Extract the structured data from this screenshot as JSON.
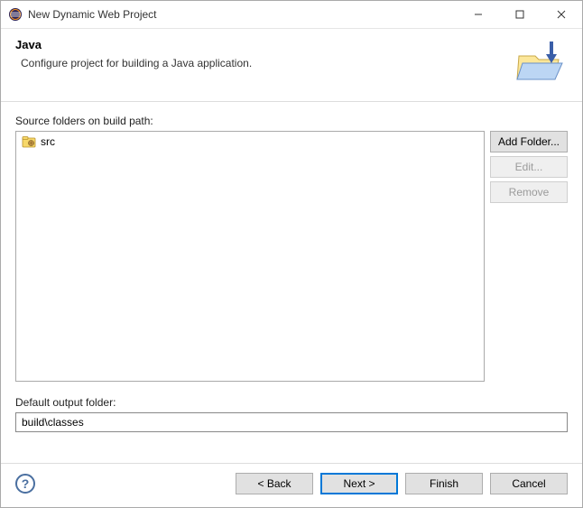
{
  "window": {
    "title": "New Dynamic Web Project"
  },
  "header": {
    "title": "Java",
    "description": "Configure project for building a Java application."
  },
  "source": {
    "label": "Source folders on build path:",
    "items": [
      {
        "name": "src"
      }
    ],
    "buttons": {
      "add": "Add Folder...",
      "edit": "Edit...",
      "remove": "Remove"
    }
  },
  "output": {
    "label": "Default output folder:",
    "value": "build\\classes"
  },
  "footer": {
    "back": "< Back",
    "next": "Next >",
    "finish": "Finish",
    "cancel": "Cancel"
  }
}
